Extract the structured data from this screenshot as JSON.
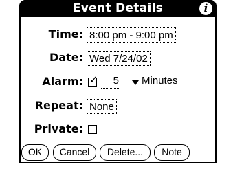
{
  "dialog": {
    "title": "Event Details",
    "info_icon": "i"
  },
  "fields": {
    "time": {
      "label": "Time:",
      "value": "8:00 pm - 9:00 pm"
    },
    "date": {
      "label": "Date:",
      "value": "Wed 7/24/02"
    },
    "alarm": {
      "label": "Alarm:",
      "checked": true,
      "checkmark": "✓",
      "value": "5",
      "units": "Minutes"
    },
    "repeat": {
      "label": "Repeat:",
      "value": "None"
    },
    "private": {
      "label": "Private:",
      "checked": false
    }
  },
  "buttons": {
    "ok": "OK",
    "cancel": "Cancel",
    "delete": "Delete...",
    "note": "Note"
  }
}
